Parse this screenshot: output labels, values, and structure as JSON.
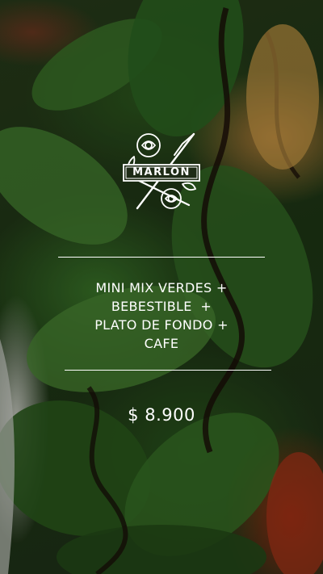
{
  "brand": {
    "logo_text": "MARLON"
  },
  "menu_item": {
    "lines": [
      "MINI MIX VERDES +",
      "BEBESTIBLE  +",
      "PLATO DE FONDO +",
      "CAFE"
    ],
    "price": "$ 8.900"
  },
  "colors": {
    "text": "#ffffff",
    "divider": "#ffffff"
  }
}
